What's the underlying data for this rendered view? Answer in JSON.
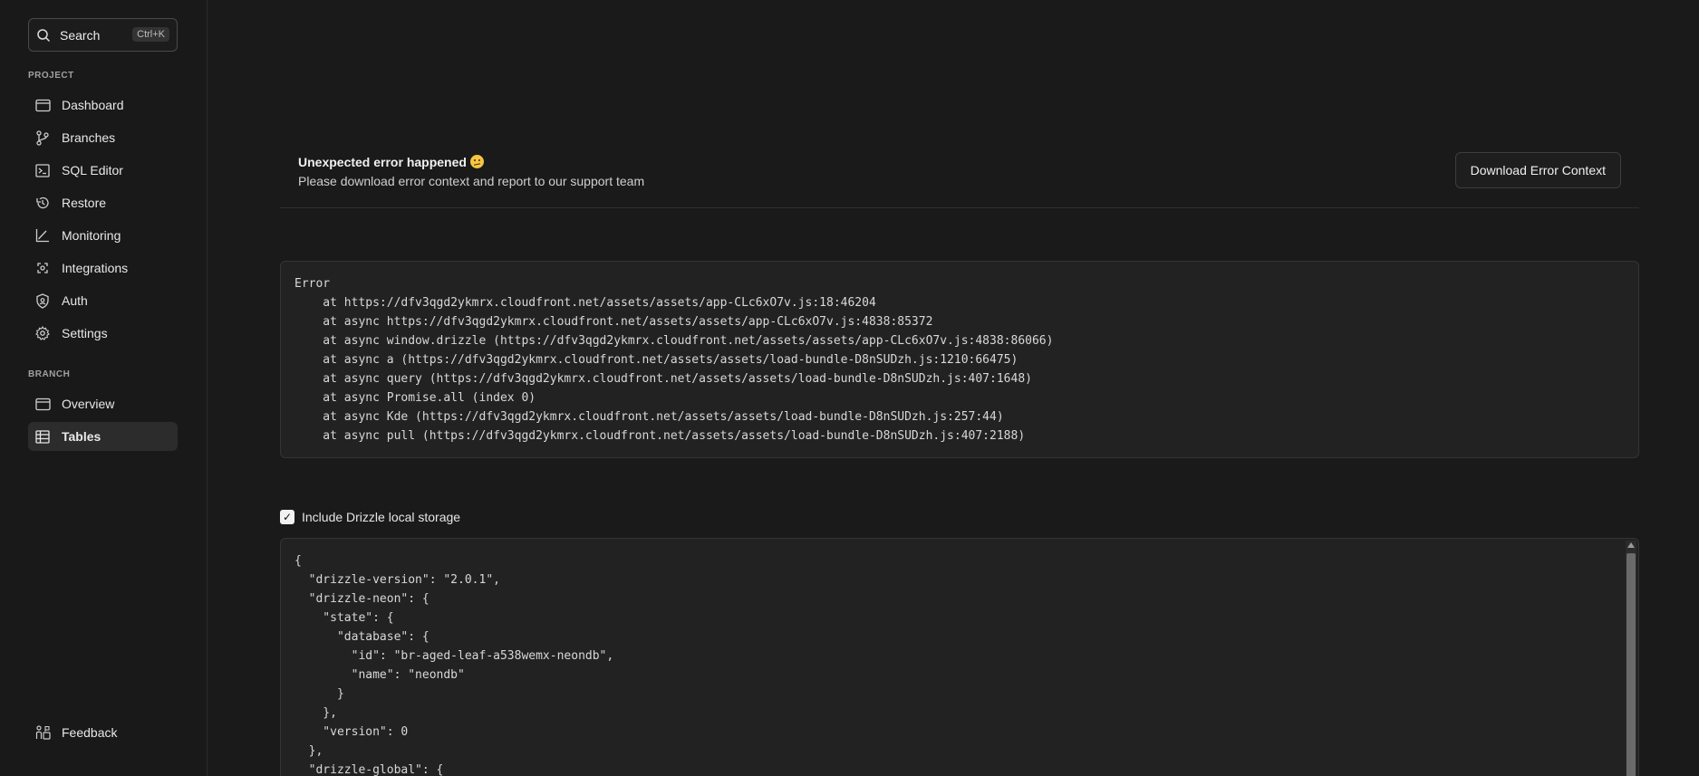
{
  "search": {
    "label": "Search",
    "shortcut": "Ctrl+K"
  },
  "sidebar": {
    "project_title": "PROJECT",
    "project_items": [
      {
        "label": "Dashboard",
        "icon": "dashboard-icon"
      },
      {
        "label": "Branches",
        "icon": "branches-icon"
      },
      {
        "label": "SQL Editor",
        "icon": "sql-editor-icon"
      },
      {
        "label": "Restore",
        "icon": "restore-icon"
      },
      {
        "label": "Monitoring",
        "icon": "monitoring-icon"
      },
      {
        "label": "Integrations",
        "icon": "integrations-icon"
      },
      {
        "label": "Auth",
        "icon": "auth-icon"
      },
      {
        "label": "Settings",
        "icon": "gear-icon"
      }
    ],
    "branch_title": "BRANCH",
    "branch_items": [
      {
        "label": "Overview",
        "icon": "overview-icon"
      },
      {
        "label": "Tables",
        "icon": "tables-icon",
        "active": true
      }
    ],
    "feedback": "Feedback"
  },
  "error": {
    "title": "Unexpected error happened",
    "subtitle": "Please download error context and report to our support team",
    "download_button": "Download Error Context",
    "stack_trace": "Error\n    at https://dfv3qgd2ykmrx.cloudfront.net/assets/assets/app-CLc6xO7v.js:18:46204\n    at async https://dfv3qgd2ykmrx.cloudfront.net/assets/assets/app-CLc6xO7v.js:4838:85372\n    at async window.drizzle (https://dfv3qgd2ykmrx.cloudfront.net/assets/assets/app-CLc6xO7v.js:4838:86066)\n    at async a (https://dfv3qgd2ykmrx.cloudfront.net/assets/assets/load-bundle-D8nSUDzh.js:1210:66475)\n    at async query (https://dfv3qgd2ykmrx.cloudfront.net/assets/assets/load-bundle-D8nSUDzh.js:407:1648)\n    at async Promise.all (index 0)\n    at async Kde (https://dfv3qgd2ykmrx.cloudfront.net/assets/assets/load-bundle-D8nSUDzh.js:257:44)\n    at async pull (https://dfv3qgd2ykmrx.cloudfront.net/assets/assets/load-bundle-D8nSUDzh.js:407:2188)"
  },
  "storage": {
    "checkbox_label": "Include Drizzle local storage",
    "checked": true,
    "json_text": "{\n  \"drizzle-version\": \"2.0.1\",\n  \"drizzle-neon\": {\n    \"state\": {\n      \"database\": {\n        \"id\": \"br-aged-leaf-a538wemx-neondb\",\n        \"name\": \"neondb\"\n      }\n    },\n    \"version\": 0\n  },\n  \"drizzle-global\": {"
  }
}
